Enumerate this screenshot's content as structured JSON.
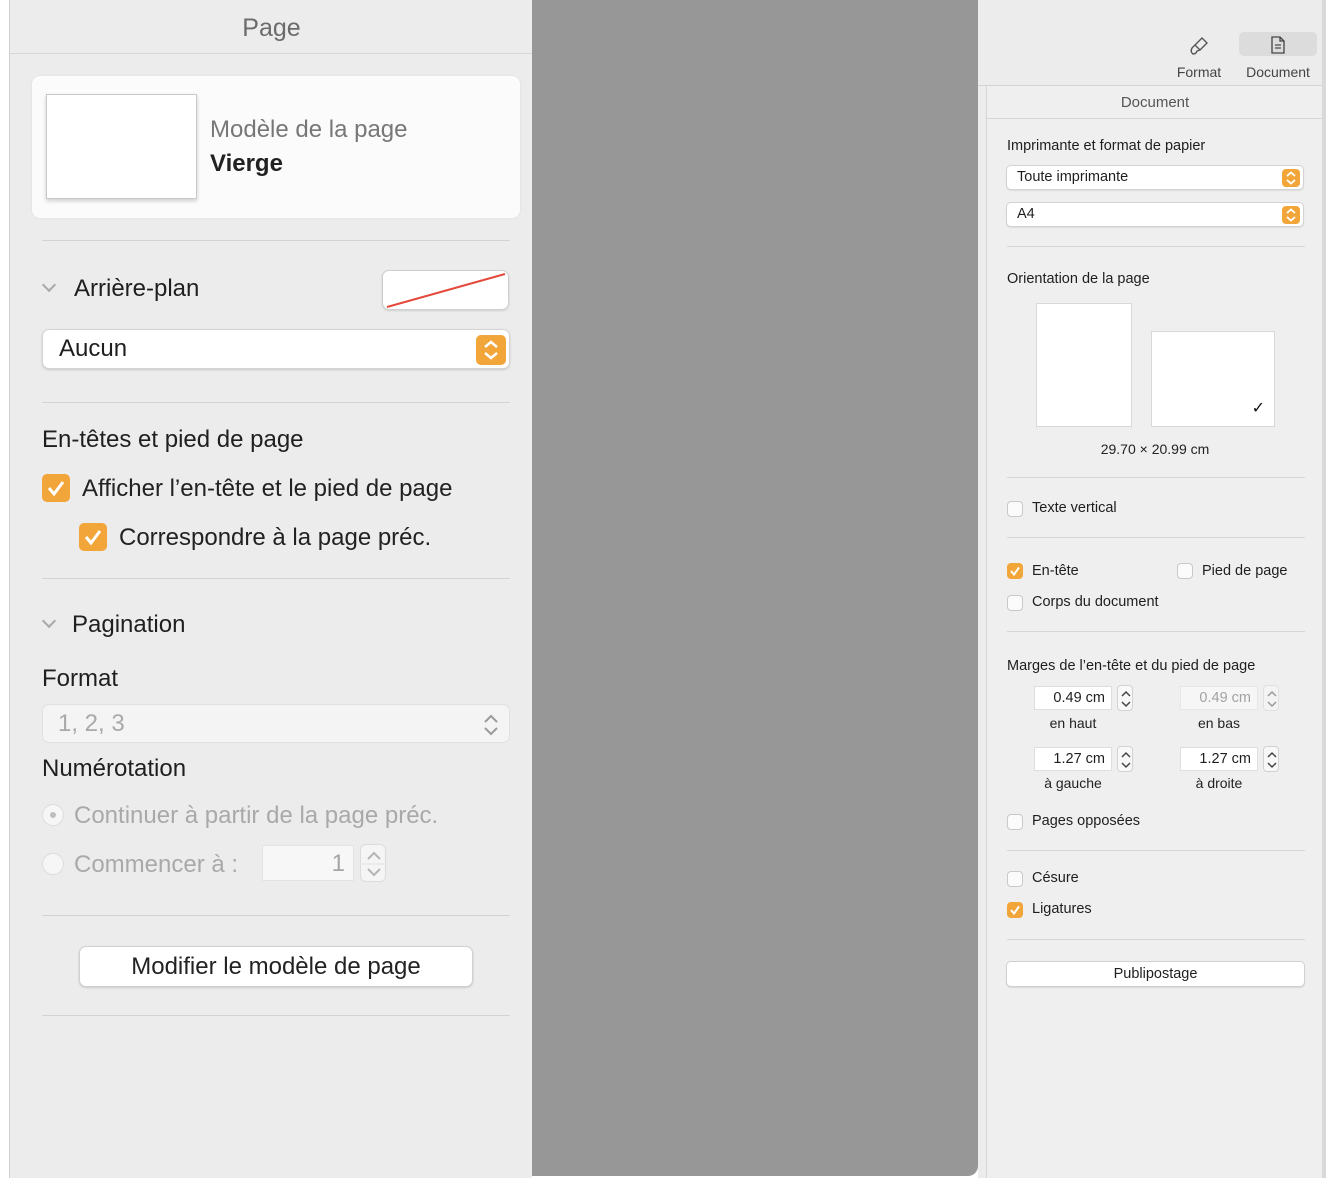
{
  "left_panel": {
    "title": "Page",
    "template": {
      "label": "Modèle de la page",
      "value": "Vierge"
    },
    "background": {
      "heading": "Arrière-plan",
      "fill_value": "Aucun",
      "swatch": "none"
    },
    "headers": {
      "heading": "En-têtes et pied de page",
      "show_header_footer": {
        "label": "Afficher l’en-tête et le pied de page",
        "checked": true
      },
      "match_previous": {
        "label": "Correspondre à la page préc.",
        "checked": true
      }
    },
    "pagination": {
      "heading": "Pagination",
      "format_label": "Format",
      "format_value": "1, 2, 3",
      "numbering_label": "Numérotation",
      "continue_label": "Continuer à partir de la page préc.",
      "start_label": "Commencer à :",
      "start_value": "1"
    },
    "edit_button": "Modifier le modèle de page"
  },
  "toolbar": {
    "tabs": [
      {
        "label": "Format",
        "icon": "paintbrush-icon",
        "active": false
      },
      {
        "label": "Document",
        "icon": "document-icon",
        "active": true
      }
    ]
  },
  "document_panel": {
    "title": "Document",
    "printer_heading": "Imprimante et format de papier",
    "printer_value": "Toute imprimante",
    "paper_value": "A4",
    "orientation_heading": "Orientation de la page",
    "page_size": "29.70 × 20.99 cm",
    "vertical_text": {
      "label": "Texte vertical",
      "checked": false
    },
    "header": {
      "label": "En-tête",
      "checked": true
    },
    "footer": {
      "label": "Pied de page",
      "checked": false
    },
    "body": {
      "label": "Corps du document",
      "checked": false
    },
    "margins_heading": "Marges de l’en-tête et du pied de page",
    "margins": {
      "top": {
        "value": "0.49 cm",
        "label": "en haut"
      },
      "bottom": {
        "value": "0.49 cm",
        "label": "en bas"
      },
      "left": {
        "value": "1.27 cm",
        "label": "à gauche"
      },
      "right": {
        "value": "1.27 cm",
        "label": "à droite"
      }
    },
    "facing_pages": {
      "label": "Pages opposées",
      "checked": false
    },
    "hyphenation": {
      "label": "Césure",
      "checked": false
    },
    "ligatures": {
      "label": "Ligatures",
      "checked": true
    },
    "mail_merge_button": "Publipostage"
  },
  "colors": {
    "accent": "#f2a63a",
    "canvas_gray": "#979797",
    "panel_bg": "#ececec"
  }
}
